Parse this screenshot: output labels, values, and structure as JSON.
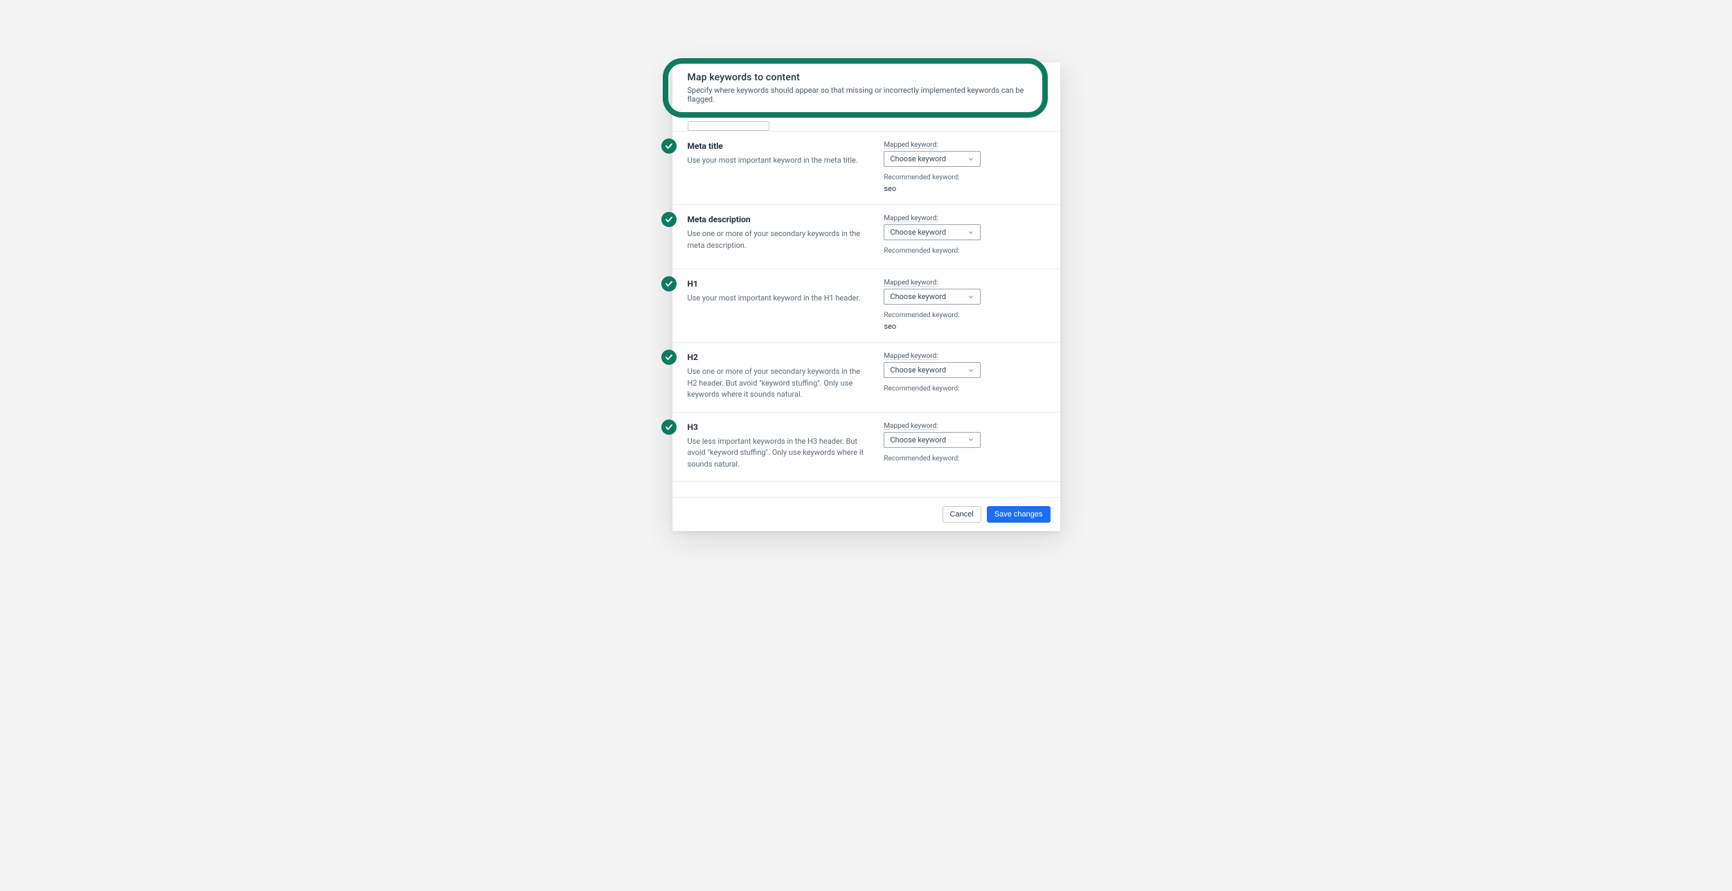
{
  "header": {
    "title": "Map keywords to content",
    "subtitle": "Specify where keywords should appear so that missing or incorrectly implemented keywords can be flagged."
  },
  "labels": {
    "mapped_keyword": "Mapped keyword:",
    "choose_keyword": "Choose keyword",
    "recommended_keyword": "Recommended keyword:"
  },
  "rows": [
    {
      "title": "Meta title",
      "desc": "Use your most important keyword in the meta title.",
      "recommended": "seo"
    },
    {
      "title": "Meta description",
      "desc": "Use one or more of your secondary keywords in the meta description.",
      "recommended": ""
    },
    {
      "title": "H1",
      "desc": "Use your most important keyword in the H1 header.",
      "recommended": "seo"
    },
    {
      "title": "H2",
      "desc": "Use one or more of your secondary keywords in the H2 header. But avoid \"keyword stuffing\". Only use keywords where it sounds natural.",
      "recommended": ""
    },
    {
      "title": "H3",
      "desc": "Use less important keywords in the H3 header. But avoid \"keyword stuffing\". Only use keywords where it sounds natural.",
      "recommended": ""
    }
  ],
  "footer": {
    "cancel": "Cancel",
    "save": "Save changes"
  }
}
